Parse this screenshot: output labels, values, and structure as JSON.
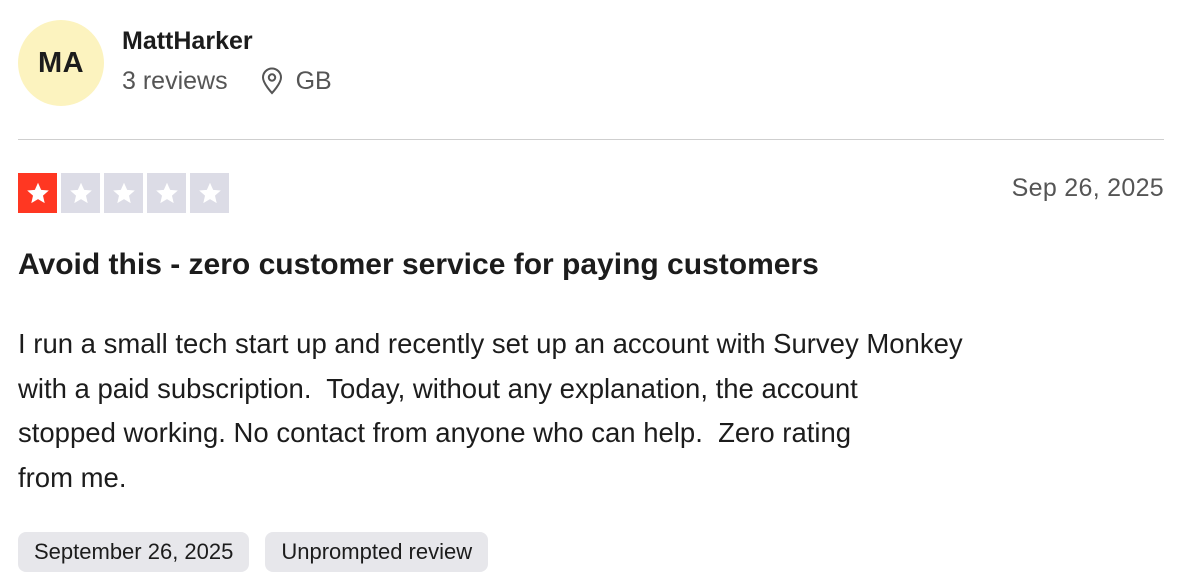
{
  "user": {
    "initials": "MA",
    "name": "MattHarker",
    "reviews_count": "3 reviews",
    "location": "GB",
    "avatar_color": "#fcf3bf"
  },
  "review": {
    "rating": 1,
    "max_rating": 5,
    "star_filled_color": "#ff3722",
    "star_empty_color": "#dcdce6",
    "date": "Sep 26, 2025",
    "title": "Avoid this - zero customer service for paying customers",
    "body_lines": [
      "I run a small tech start up and recently set up an account with Survey Monkey",
      "with a paid subscription.  Today, without any explanation, the account",
      "stopped working. No contact from anyone who can help.  Zero rating",
      "from me."
    ],
    "tags": {
      "experience_date": "September 26, 2025",
      "review_type": "Unprompted review"
    }
  }
}
